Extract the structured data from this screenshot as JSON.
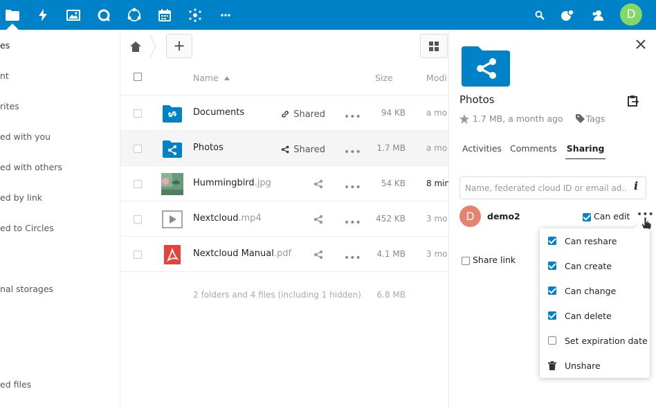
{
  "colors": {
    "brand": "#0082c9",
    "avatar_user": "#84d868",
    "avatar_share": "#e68370",
    "checkbox": "#0082c9"
  },
  "header": {
    "apps": [
      {
        "name": "files",
        "icon": "folder-icon",
        "active": true
      },
      {
        "name": "activity",
        "icon": "lightning-icon"
      },
      {
        "name": "gallery",
        "icon": "image-icon"
      },
      {
        "name": "talk",
        "icon": "talk-icon"
      },
      {
        "name": "circles",
        "icon": "circles-icon"
      },
      {
        "name": "calendar",
        "icon": "calendar-icon"
      },
      {
        "name": "social",
        "icon": "dots-cluster-icon"
      },
      {
        "name": "more",
        "icon": "more-icon"
      }
    ],
    "avatar_letter": "D"
  },
  "sidebar": {
    "items": [
      {
        "label": "es"
      },
      {
        "label": "nt"
      },
      {
        "label": "rites"
      },
      {
        "label": "ed with you"
      },
      {
        "label": "ed with others"
      },
      {
        "label": "ed by link"
      },
      {
        "label": "ed to Circles"
      },
      {
        "label": "nal storages"
      },
      {
        "label": "ed files"
      },
      {
        "label": "-"
      }
    ]
  },
  "toolbar": {
    "new_label": "+"
  },
  "table": {
    "headers": {
      "name": "Name",
      "size": "Size",
      "modified": "Modi"
    },
    "rows": [
      {
        "name": "Documents",
        "ext": "",
        "shared": "Shared",
        "size": "94 KB",
        "modified": "a mo"
      },
      {
        "name": "Photos",
        "ext": "",
        "shared": "Shared",
        "size": "1.7 MB",
        "modified": "a mo"
      },
      {
        "name": "Hummingbird",
        "ext": ".jpg",
        "shared": "",
        "size": "54 KB",
        "modified": "8 min"
      },
      {
        "name": "Nextcloud",
        "ext": ".mp4",
        "shared": "",
        "size": "452 KB",
        "modified": "3 mo"
      },
      {
        "name": "Nextcloud Manual",
        "ext": ".pdf",
        "shared": "",
        "size": "4.1 MB",
        "modified": "3 mo"
      }
    ],
    "summary": "2 folders and 4 files (including 1 hidden)",
    "summary_size": "6.8 MB"
  },
  "details": {
    "title": "Photos",
    "meta": "1.7 MB, a month ago",
    "tags": "Tags",
    "tabs": [
      "Activities",
      "Comments",
      "Sharing"
    ],
    "share_placeholder": "Name, federated cloud ID or email ad...",
    "share_user": {
      "letter": "D",
      "name": "demo2",
      "can_edit": "Can edit"
    },
    "share_link": "Share link",
    "menu": [
      {
        "label": "Can reshare",
        "checked": true
      },
      {
        "label": "Can create",
        "checked": true
      },
      {
        "label": "Can change",
        "checked": true
      },
      {
        "label": "Can delete",
        "checked": true
      },
      {
        "label": "Set expiration date",
        "checked": false
      },
      {
        "label": "Unshare"
      }
    ]
  }
}
